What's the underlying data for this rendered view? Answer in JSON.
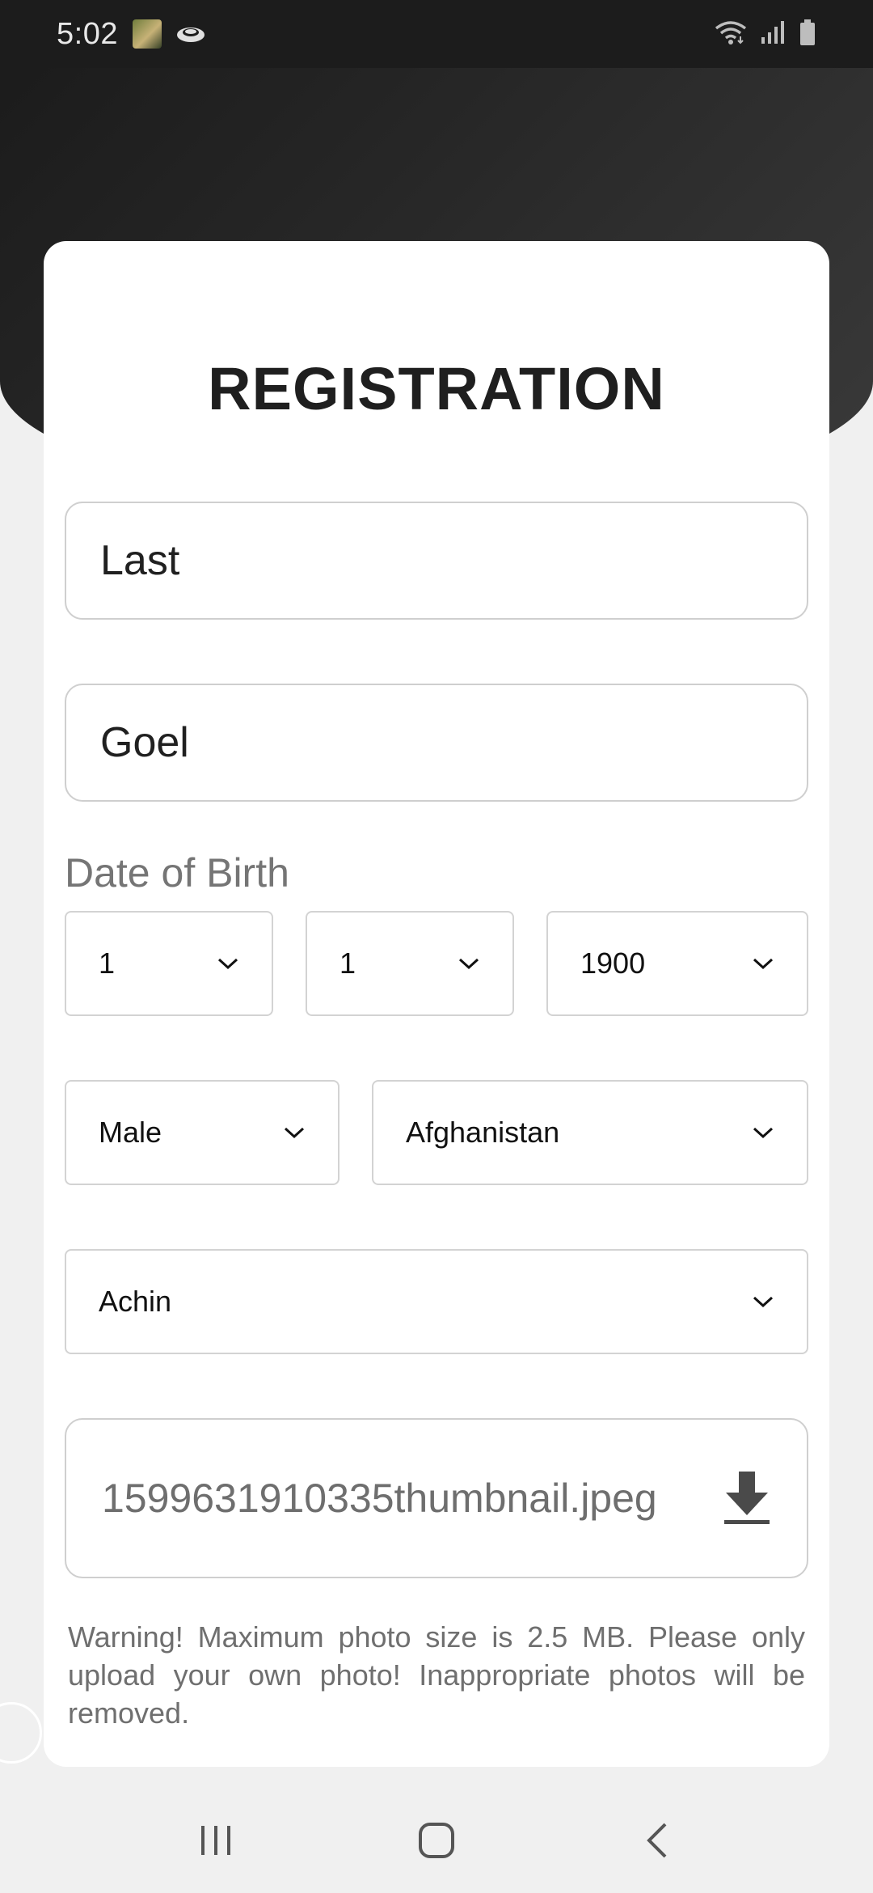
{
  "status_bar": {
    "time": "5:02",
    "icons": [
      "app-thumbnail-icon",
      "cloud-icon",
      "wifi-icon",
      "signal-icon",
      "battery-icon"
    ]
  },
  "form": {
    "title": "REGISTRATION",
    "last_name_value": "Last",
    "first_name_value": "Goel",
    "dob_label": "Date of Birth",
    "dob_day": "1",
    "dob_month": "1",
    "dob_year": "1900",
    "gender": "Male",
    "country": "Afghanistan",
    "city": "Achin",
    "photo_filename": "1599631910335thumbnail.jpeg",
    "warning": "Warning! Maximum photo size is 2.5 MB. Please only upload your own photo! Inappropriate photos will be removed."
  },
  "nav_bar": {
    "buttons": [
      "recent-apps-icon",
      "home-icon",
      "back-icon"
    ]
  },
  "colors": {
    "header_dark": "#1f1f1f",
    "card": "#ffffff",
    "background": "#f0f0f0",
    "border": "#cfcfcf"
  }
}
